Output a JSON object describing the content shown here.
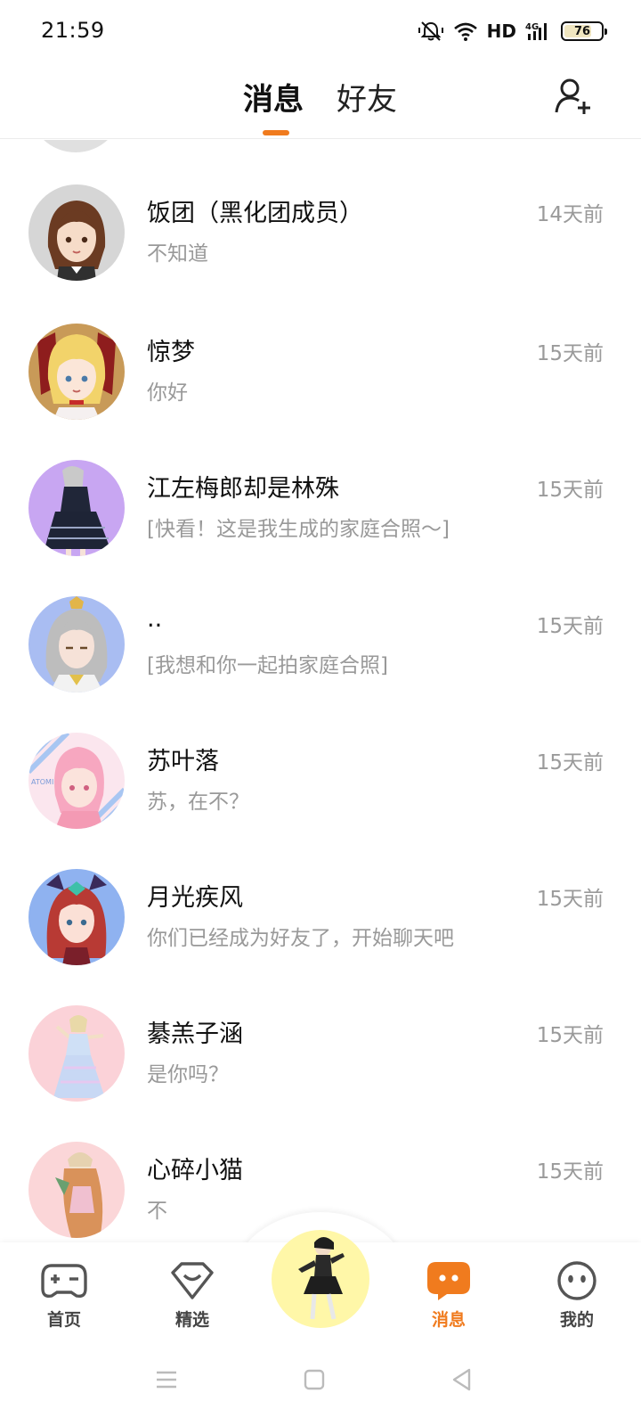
{
  "status_bar": {
    "time": "21:59",
    "network": "HD",
    "signal": "4G",
    "battery": "76",
    "battery_level": 0.76
  },
  "header": {
    "tab_messages": "消息",
    "tab_friends": "好友",
    "active_tab": "消息",
    "add_friend_icon": "add-user-icon",
    "accent_color": "#f07b1e"
  },
  "conversations": [
    {
      "name": "饭团（黑化团成员）",
      "preview": "不知道",
      "time": "14天前"
    },
    {
      "name": "惊梦",
      "preview": "你好",
      "time": "15天前"
    },
    {
      "name": "江左梅郎却是林殊",
      "preview": "[快看！这是我生成的家庭合照～]",
      "time": "15天前"
    },
    {
      "name": "..",
      "preview": "[我想和你一起拍家庭合照]",
      "time": "15天前"
    },
    {
      "name": "苏叶落",
      "preview": "苏，在不？",
      "time": "15天前"
    },
    {
      "name": "月光疾风",
      "preview": "你们已经成为好友了，开始聊天吧",
      "time": "15天前"
    },
    {
      "name": "綦羔子涵",
      "preview": "是你吗？",
      "time": "15天前"
    },
    {
      "name": "心碎小猫",
      "preview": "不",
      "time": "15天前"
    }
  ],
  "bottom_nav": {
    "home": "首页",
    "featured": "精选",
    "messages": "消息",
    "me": "我的",
    "active": "消息"
  },
  "avatar_text": "ATOMI"
}
